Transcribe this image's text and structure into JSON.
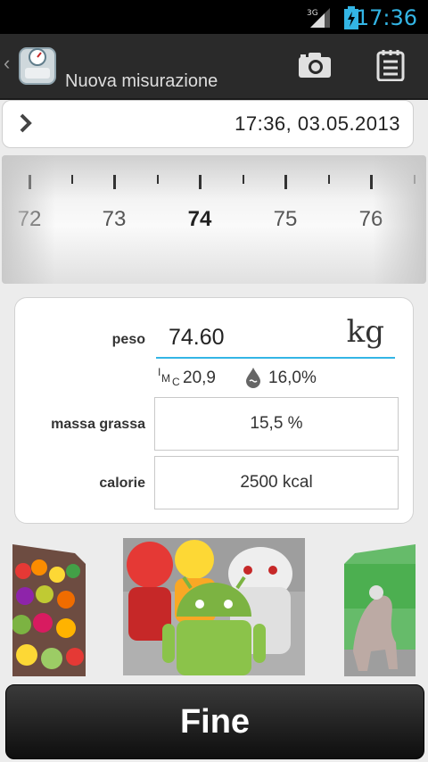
{
  "status_bar": {
    "network": "3G",
    "time": "17:36",
    "time_color": "#33b5e5"
  },
  "action_bar": {
    "title": "Nuova misurazione",
    "icons": [
      "scale-logo-icon",
      "camera-icon",
      "notepad-icon"
    ]
  },
  "date_bar": {
    "value": "17:36,  03.05.2013"
  },
  "ruler": {
    "labels": [
      "72",
      "73",
      "74",
      "75",
      "76"
    ],
    "selected": "74"
  },
  "form": {
    "peso_label": "peso",
    "peso_value": "74.60",
    "peso_unit": "kg",
    "imc_value": "20,9",
    "fat_value": "16,0%",
    "massa_label": "massa grassa",
    "massa_value": "15,5 %",
    "calorie_label": "calorie",
    "calorie_value": "2500 kcal"
  },
  "photos": {
    "items": [
      "fruit-market-photo",
      "android-toys-photo",
      "sculpture-park-photo"
    ]
  },
  "footer": {
    "button_label": "Fine"
  }
}
